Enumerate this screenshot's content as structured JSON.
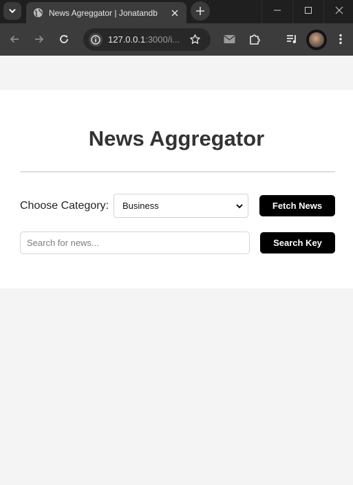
{
  "browser": {
    "tab": {
      "title": "News Agreggator | Jonatandb"
    },
    "address_bar": {
      "url_host": "127.0.0.1",
      "url_rest": ":3000/i..."
    }
  },
  "page": {
    "title": "News Aggregator",
    "category_label": "Choose Category:",
    "category_selected": "Business",
    "fetch_button": "Fetch News",
    "search_placeholder": "Search for news...",
    "search_button": "Search Key"
  },
  "colors": {
    "accent": "#000000",
    "page_background": "#f4f4f4",
    "card_background": "#ffffff",
    "title_text": "#333333"
  },
  "icons": [
    "chevron-down-icon",
    "globe-icon",
    "close-icon",
    "plus-icon",
    "minimize-icon",
    "maximize-icon",
    "back-icon",
    "forward-icon",
    "reload-icon",
    "info-icon",
    "star-icon",
    "mail-icon",
    "extensions-icon",
    "media-queue-icon",
    "kebab-menu-icon"
  ]
}
